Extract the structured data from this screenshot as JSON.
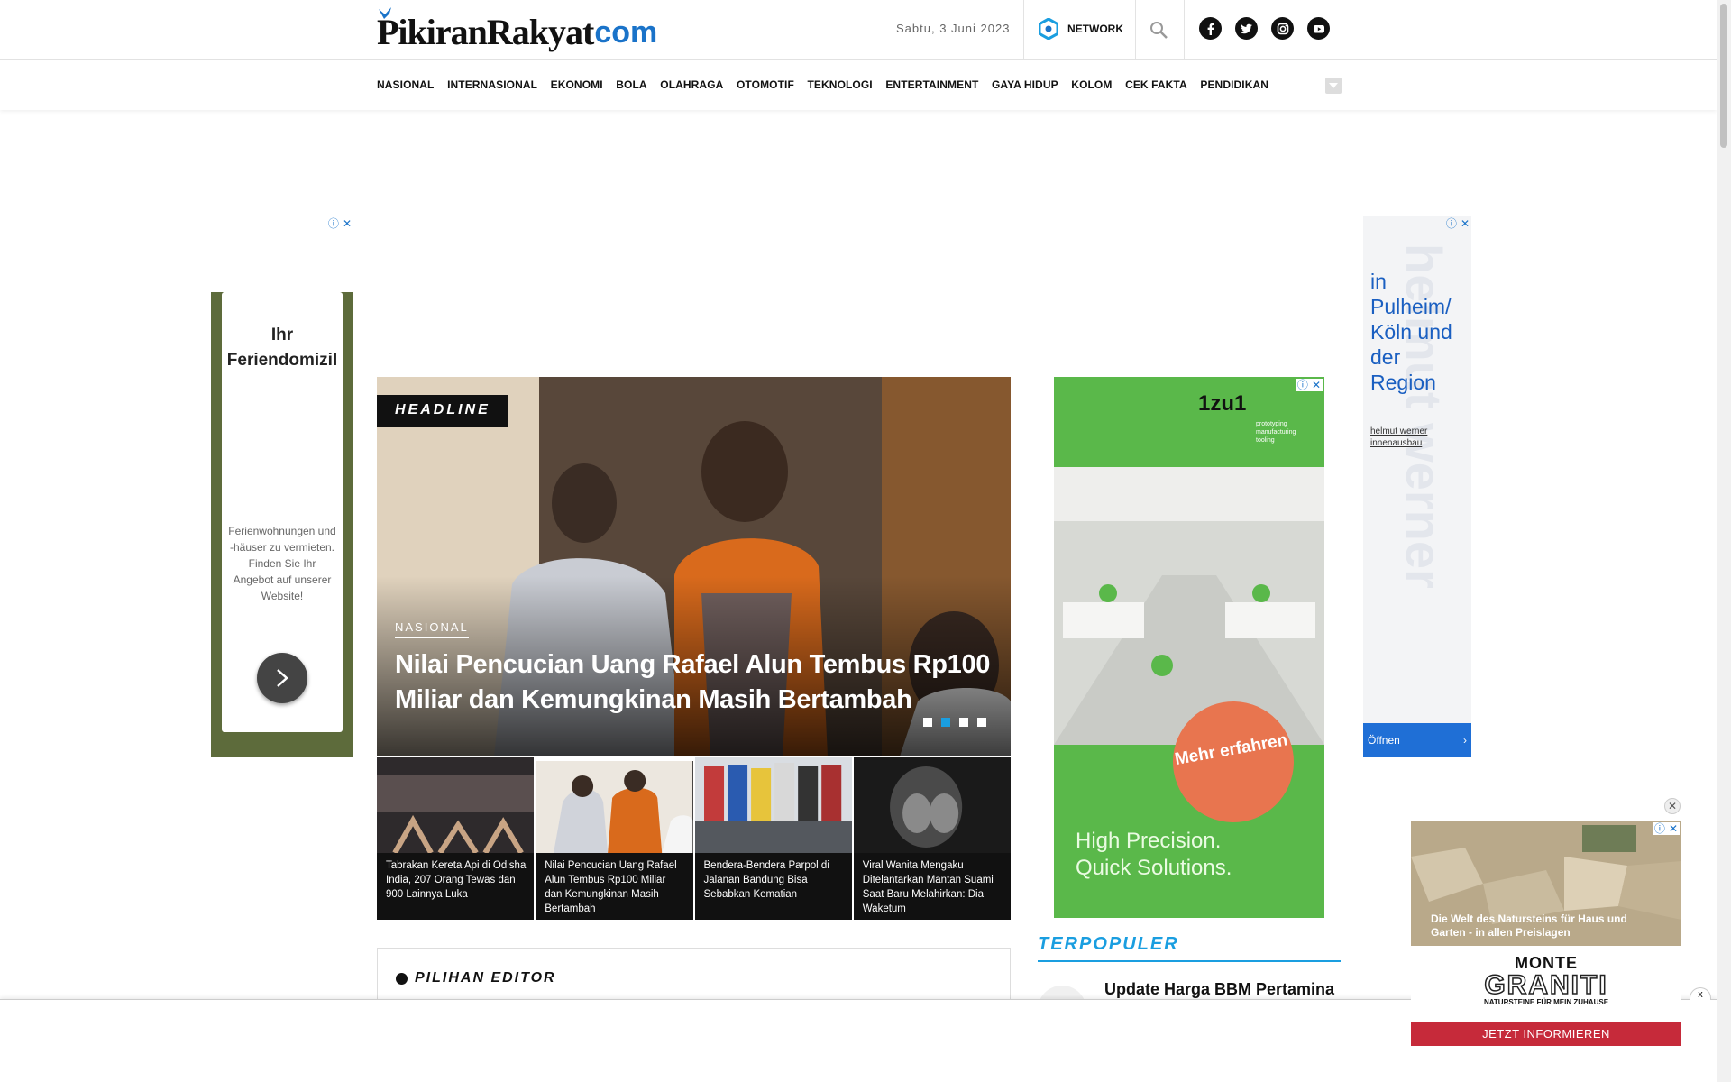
{
  "header": {
    "logo_text": "PikiranRakyat",
    "logo_com": "com",
    "date": "Sabtu, 3 Juni 2023",
    "network_label": "NETWORK",
    "socials": [
      "facebook-icon",
      "twitter-icon",
      "instagram-icon",
      "youtube-icon"
    ]
  },
  "nav": {
    "items": [
      "NASIONAL",
      "INTERNASIONAL",
      "EKONOMI",
      "BOLA",
      "OLAHRAGA",
      "OTOMOTIF",
      "TEKNOLOGI",
      "ENTERTAINMENT",
      "GAYA HIDUP",
      "KOLOM",
      "CEK FAKTA",
      "PENDIDIKAN"
    ]
  },
  "ads": {
    "left": {
      "title": "Ihr Feriendomizil",
      "text": "Ferienwohnungen und -häuser zu vermieten. Finden Sie Ihr Angebot auf unserer Website!"
    },
    "right": {
      "headline": "in Pulheim/ Köln und der Region",
      "brand": "helmut werner innenausbau",
      "button": "Öffnen"
    },
    "mid": {
      "brand": "1zu1",
      "sub": "prototyping manufacturing tooling",
      "cta": "Mehr erfahren",
      "slogan": "High Precision. Quick Solutions."
    },
    "float": {
      "caption": "Die Welt des Natursteins für Haus und Garten - in allen Preislagen",
      "brand_top": "MONTE",
      "brand_main": "GRANITI",
      "brand_sub": "NATURSTEINE FÜR MEIN ZUHAUSE",
      "cta": "JETZT INFORMIEREN"
    },
    "close_x": "x"
  },
  "headline": {
    "tag": "HEADLINE",
    "category": "NASIONAL",
    "title": "Nilai Pencucian Uang Rafael Alun Tembus Rp100 Miliar dan Kemungkinan Masih Bertambah",
    "active_dot": 2,
    "dot_count": 4
  },
  "thumbs": [
    {
      "caption": "Tabrakan Kereta Api di Odisha India, 207 Orang Tewas dan 900 Lainnya Luka"
    },
    {
      "caption": "Nilai Pencucian Uang Rafael Alun Tembus Rp100 Miliar dan Kemungkinan Masih Bertambah"
    },
    {
      "caption": "Bendera-Bendera Parpol di Jalanan Bandung Bisa Sebabkan Kematian"
    },
    {
      "caption": "Viral Wanita Mengaku Ditelantarkan Mantan Suami Saat Baru Melahirkan: Dia Waketum"
    }
  ],
  "pilihan_editor": {
    "title": "PILIHAN EDITOR"
  },
  "terpopuler": {
    "title": "TERPOPULER",
    "first_item": "Update Harga BBM Pertamina"
  }
}
